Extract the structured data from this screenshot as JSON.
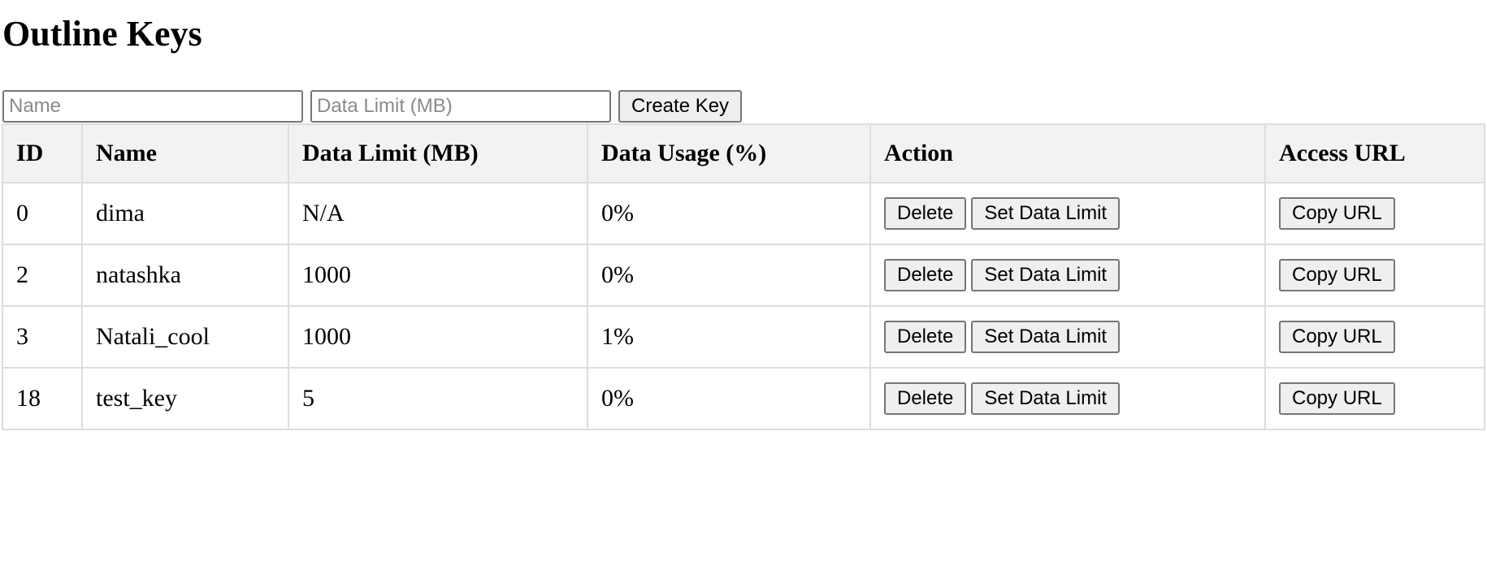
{
  "page": {
    "title": "Outline Keys"
  },
  "create_form": {
    "name_placeholder": "Name",
    "limit_placeholder": "Data Limit (MB)",
    "create_label": "Create Key"
  },
  "table": {
    "headers": [
      "ID",
      "Name",
      "Data Limit (MB)",
      "Data Usage (%)",
      "Action",
      "Access URL"
    ],
    "rows": [
      {
        "id": "0",
        "name": "dima",
        "limit": "N/A",
        "usage": "0%"
      },
      {
        "id": "2",
        "name": "natashka",
        "limit": "1000",
        "usage": "0%"
      },
      {
        "id": "3",
        "name": "Natali_cool",
        "limit": "1000",
        "usage": "1%"
      },
      {
        "id": "18",
        "name": "test_key",
        "limit": "5",
        "usage": "0%"
      }
    ],
    "delete_label": "Delete",
    "set_limit_label": "Set Data Limit",
    "copy_url_label": "Copy URL"
  }
}
